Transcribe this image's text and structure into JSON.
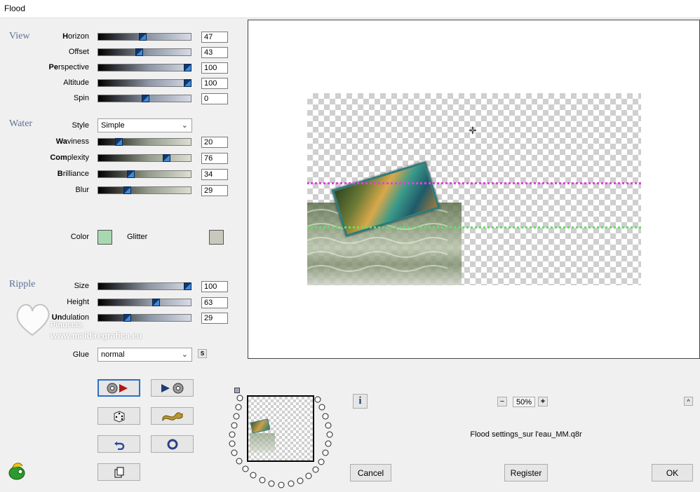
{
  "window": {
    "title": "Flood"
  },
  "view": {
    "heading": "View",
    "horizon": {
      "label_bold": "H",
      "label_rest": "orizon",
      "value": "47",
      "level": 0.47
    },
    "offset": {
      "label_bold": "",
      "label_rest": "Offset",
      "value": "43",
      "level": 0.43
    },
    "perspective": {
      "label_bold": "Pe",
      "label_rest": "rspective",
      "value": "100",
      "level": 1.0
    },
    "altitude": {
      "label_bold": "",
      "label_rest": "Altitude",
      "value": "100",
      "level": 1.0
    },
    "spin": {
      "label_bold": "",
      "label_rest": "Spin",
      "value": "0",
      "level": 0.5
    }
  },
  "water": {
    "heading": "Water",
    "style": {
      "label": "Style",
      "value": "Simple"
    },
    "waviness": {
      "label_bold": "Wa",
      "label_rest": "viness",
      "value": "20",
      "level": 0.2
    },
    "complexity": {
      "label_bold": "Com",
      "label_rest": "plexity",
      "value": "76",
      "level": 0.76
    },
    "brilliance": {
      "label_bold": "B",
      "label_rest": "rilliance",
      "value": "34",
      "level": 0.34
    },
    "blur": {
      "label_bold": "",
      "label_rest": "Blur",
      "value": "29",
      "level": 0.29
    },
    "color": {
      "label": "Color",
      "hex": "#a8d8b0"
    },
    "glitter": {
      "label": "Glitter",
      "hex": "#c8c8bc"
    }
  },
  "ripple": {
    "heading": "Ripple",
    "size": {
      "label_bold": "",
      "label_rest": "Size",
      "value": "100",
      "level": 1.0
    },
    "height": {
      "label_bold": "",
      "label_rest": "Height",
      "value": "63",
      "level": 0.63
    },
    "undulation": {
      "label_bold": "Un",
      "label_rest": "dulation",
      "value": "29",
      "level": 0.29
    },
    "glue": {
      "label": "Glue",
      "value": "normal"
    },
    "s_button": "S"
  },
  "watermark": {
    "line1": "Pinuccia",
    "line2": "www.maidiregrafica.eu"
  },
  "zoom": {
    "value": "50%",
    "minus": "−",
    "plus": "+"
  },
  "settings_file": "Flood settings_sur l'eau_MM.q8r",
  "buttons": {
    "cancel": "Cancel",
    "register": "Register",
    "ok": "OK",
    "info": "i",
    "collapse": "^"
  },
  "colors": {
    "accent": "#2c6fc9",
    "heading": "#5f7096",
    "horizon_line": "#e040e0",
    "water_line": "#66dd66"
  }
}
